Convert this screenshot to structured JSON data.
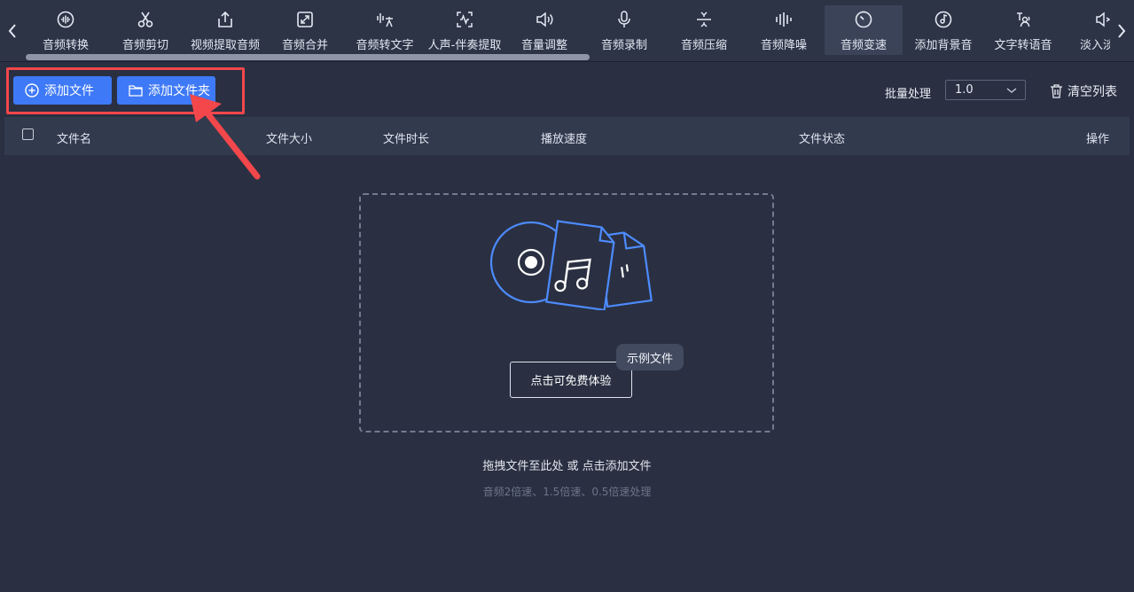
{
  "toolbar": {
    "tools": [
      {
        "label": "音频转换",
        "icon": "waveform-circle-icon"
      },
      {
        "label": "音频剪切",
        "icon": "scissors-icon"
      },
      {
        "label": "视频提取音频",
        "icon": "upload-box-icon"
      },
      {
        "label": "音频合并",
        "icon": "merge-arrows-icon"
      },
      {
        "label": "音频转文字",
        "icon": "sound-to-text-icon"
      },
      {
        "label": "人声-伴奏提取",
        "icon": "scan-wave-icon"
      },
      {
        "label": "音量调整",
        "icon": "speaker-icon"
      },
      {
        "label": "音频录制",
        "icon": "microphone-icon"
      },
      {
        "label": "音频压缩",
        "icon": "compress-icon"
      },
      {
        "label": "音频降噪",
        "icon": "noise-bars-icon"
      },
      {
        "label": "音频变速",
        "icon": "speedometer-icon",
        "active": true
      },
      {
        "label": "添加背景音",
        "icon": "music-disc-icon"
      },
      {
        "label": "文字转语音",
        "icon": "text-to-speech-icon"
      },
      {
        "label": "淡入淡出",
        "icon": "fade-speaker-icon"
      }
    ]
  },
  "actions": {
    "add_file": "添加文件",
    "add_folder": "添加文件夹",
    "batch_label": "批量处理",
    "speed_value": "1.0",
    "clear_list": "清空列表"
  },
  "table": {
    "columns": [
      "文件名",
      "文件大小",
      "文件时长",
      "播放速度",
      "文件状态",
      "操作"
    ]
  },
  "dropzone": {
    "try_button": "点击可免费体验",
    "sample_tag": "示例文件",
    "hint_main": "拖拽文件至此处 或 点击添加文件",
    "hint_sub": "音频2倍速、1.5倍速、0.5倍速处理"
  },
  "colors": {
    "background": "#2a3042",
    "accent": "#3e79f7",
    "highlight_box": "#f3474b"
  }
}
